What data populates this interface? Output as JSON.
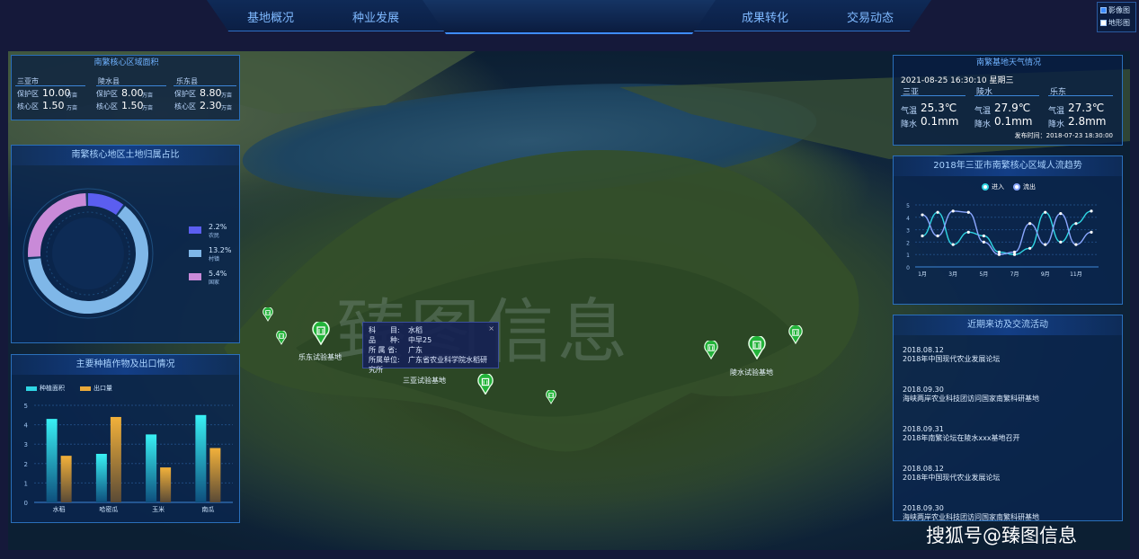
{
  "nav": {
    "tabs": [
      "基地概况",
      "种业发展",
      "成果转化",
      "交易动态"
    ]
  },
  "layers": {
    "satellite": "影像图",
    "terrain": "地形图"
  },
  "area_panel": {
    "title": "南繁核心区域面积",
    "cities": [
      {
        "name": "三亚市",
        "protect_label": "保护区",
        "protect": "10.00",
        "core_label": "核心区",
        "core": "1.50",
        "unit": "万亩"
      },
      {
        "name": "陵水县",
        "protect_label": "保护区",
        "protect": "8.00",
        "core_label": "核心区",
        "core": "1.50",
        "unit": "万亩"
      },
      {
        "name": "乐东县",
        "protect_label": "保护区",
        "protect": "8.80",
        "core_label": "核心区",
        "core": "2.30",
        "unit": "万亩"
      }
    ]
  },
  "land_panel": {
    "title": "南繁核心地区土地归属占比",
    "legend": [
      {
        "pct": "2.2%",
        "label": "农民",
        "color": "#5b5ef0"
      },
      {
        "pct": "13.2%",
        "label": "村镇",
        "color": "#7fb7e8"
      },
      {
        "pct": "5.4%",
        "label": "国家",
        "color": "#c98ad8"
      }
    ],
    "values": [
      2.2,
      13.2,
      5.4
    ]
  },
  "crop_panel": {
    "title": "主要种植作物及出口情况",
    "legend": [
      "种植面积",
      "出口量"
    ]
  },
  "chart_data": [
    {
      "type": "bar",
      "categories": [
        "水稻",
        "哈密瓜",
        "玉米",
        "南瓜"
      ],
      "series": [
        {
          "name": "种植面积",
          "values": [
            4.3,
            2.5,
            3.5,
            4.5
          ]
        },
        {
          "name": "出口量",
          "values": [
            2.4,
            4.4,
            1.8,
            2.8
          ]
        }
      ],
      "ylim": [
        0,
        5
      ],
      "yticks": [
        "0",
        "1",
        "2",
        "3",
        "4",
        "5"
      ]
    },
    {
      "type": "line",
      "title": "2018年三亚市南繁核心区域人流趋势",
      "x": [
        "1月",
        "2月",
        "3月",
        "4月",
        "5月",
        "6月",
        "7月",
        "8月",
        "9月",
        "10月",
        "11月",
        "12月"
      ],
      "xticks": [
        "1月",
        "3月",
        "5月",
        "7月",
        "9月",
        "11月"
      ],
      "series": [
        {
          "name": "进入",
          "values": [
            2.5,
            4.4,
            1.8,
            2.8,
            2.5,
            1.2,
            1,
            1.5,
            4.4,
            2.0,
            3.5,
            4.5
          ]
        },
        {
          "name": "流出",
          "values": [
            4.2,
            2.5,
            4.5,
            4.4,
            2.0,
            1.0,
            1.2,
            3.5,
            1.8,
            4.3,
            1.8,
            2.8
          ]
        }
      ],
      "ylim": [
        0,
        5
      ],
      "yticks": [
        "0",
        "1",
        "2",
        "3",
        "4",
        "5"
      ]
    }
  ],
  "weather_panel": {
    "title": "南繁基地天气情况",
    "datetime": "2021-08-25 16:30:10 星期三",
    "cities": [
      {
        "name": "三亚",
        "temp_label": "气温",
        "temp": "25.3℃",
        "rain_label": "降水",
        "rain": "0.1mm"
      },
      {
        "name": "陵水",
        "temp_label": "气温",
        "temp": "27.9℃",
        "rain_label": "降水",
        "rain": "0.1mm"
      },
      {
        "name": "乐东",
        "temp_label": "气温",
        "temp": "27.3℃",
        "rain_label": "降水",
        "rain": "2.8mm"
      }
    ],
    "publish": "发布时间：2018-07-23 18:30:00"
  },
  "visits_panel": {
    "title": "近期来访及交流活动",
    "events": [
      {
        "date": "2018.08.12",
        "title": "2018年中国现代农业发展论坛"
      },
      {
        "date": "2018.09.30",
        "title": "海峡两岸农业科技团访问国家南繁科研基地"
      },
      {
        "date": "2018.09.31",
        "title": "2018年南繁论坛在陵水xxx基地召开"
      },
      {
        "date": "2018.08.12",
        "title": "2018年中国现代农业发展论坛"
      },
      {
        "date": "2018.09.30",
        "title": "海峡两岸农业科技团访问国家南繁科研基地"
      }
    ]
  },
  "map": {
    "labels": [
      "乐东试验基地",
      "三亚试验基地",
      "陵水试验基地"
    ],
    "popup": {
      "rows": [
        {
          "k": "科　　目:",
          "v": "水稻"
        },
        {
          "k": "品　　种:",
          "v": "中早25"
        },
        {
          "k": "所 属 省:",
          "v": "广东"
        },
        {
          "k": "所属单位:",
          "v": "广东省农业科学院水稻研究所"
        }
      ],
      "close": "×"
    },
    "watermark": "臻图信息",
    "source_watermark": "搜狐号@臻图信息"
  }
}
